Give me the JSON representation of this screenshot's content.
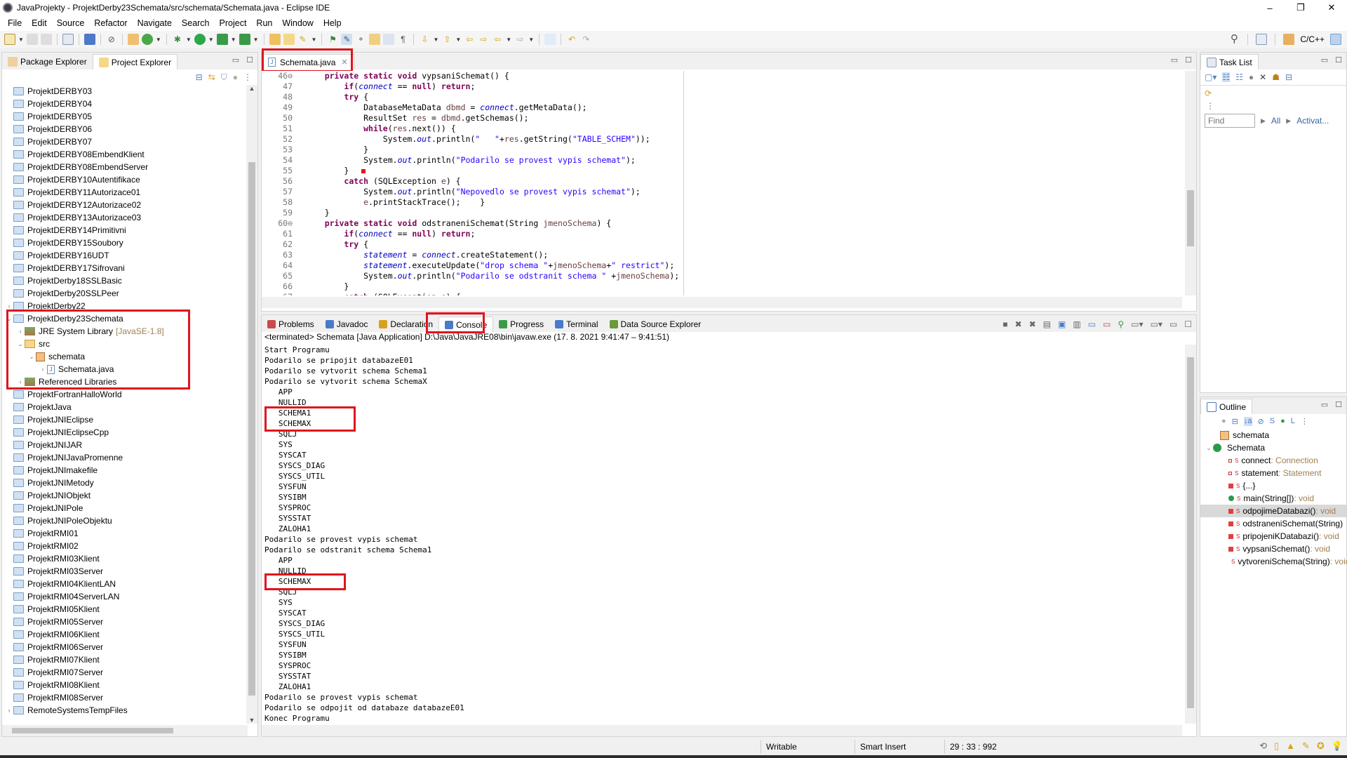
{
  "window": {
    "title": "JavaProjekty - ProjektDerby23Schemata/src/schemata/Schemata.java - Eclipse IDE",
    "controls": [
      "–",
      "❐",
      "✕"
    ]
  },
  "menu": [
    "File",
    "Edit",
    "Source",
    "Refactor",
    "Navigate",
    "Search",
    "Project",
    "Run",
    "Window",
    "Help"
  ],
  "toolbar": {
    "perspective_label": "C/C++"
  },
  "left_panel": {
    "tabs": [
      {
        "label": "Package Explorer",
        "active": false
      },
      {
        "label": "Project Explorer",
        "active": true
      }
    ],
    "tree": [
      {
        "label": "ProjektDERBY03",
        "level": 0,
        "type": "project"
      },
      {
        "label": "ProjektDERBY04",
        "level": 0,
        "type": "project"
      },
      {
        "label": "ProjektDERBY05",
        "level": 0,
        "type": "project"
      },
      {
        "label": "ProjektDERBY06",
        "level": 0,
        "type": "project"
      },
      {
        "label": "ProjektDERBY07",
        "level": 0,
        "type": "project"
      },
      {
        "label": "ProjektDERBY08EmbendKlient",
        "level": 0,
        "type": "project"
      },
      {
        "label": "ProjektDERBY08EmbendServer",
        "level": 0,
        "type": "project"
      },
      {
        "label": "ProjektDERBY10Autentifikace",
        "level": 0,
        "type": "project"
      },
      {
        "label": "ProjektDERBY11Autorizace01",
        "level": 0,
        "type": "project"
      },
      {
        "label": "ProjektDERBY12Autorizace02",
        "level": 0,
        "type": "project"
      },
      {
        "label": "ProjektDERBY13Autorizace03",
        "level": 0,
        "type": "project"
      },
      {
        "label": "ProjektDERBY14Primitivni",
        "level": 0,
        "type": "project"
      },
      {
        "label": "ProjektDERBY15Soubory",
        "level": 0,
        "type": "project"
      },
      {
        "label": "ProjektDERBY16UDT",
        "level": 0,
        "type": "project"
      },
      {
        "label": "ProjektDERBY17Sifrovani",
        "level": 0,
        "type": "project"
      },
      {
        "label": "ProjektDerby18SSLBasic",
        "level": 0,
        "type": "project"
      },
      {
        "label": "ProjektDerby20SSLPeer",
        "level": 0,
        "type": "project"
      },
      {
        "label": "ProjektDerby22",
        "level": 0,
        "type": "project-open",
        "twisty": ">"
      },
      {
        "label": "ProjektDerby23Schemata",
        "level": 0,
        "type": "project-open",
        "twisty": "v"
      },
      {
        "label": "JRE System Library",
        "suffix": "[JavaSE-1.8]",
        "level": 1,
        "type": "library",
        "twisty": ">"
      },
      {
        "label": "src",
        "level": 1,
        "type": "src",
        "twisty": "v"
      },
      {
        "label": "schemata",
        "level": 2,
        "type": "package",
        "twisty": "v"
      },
      {
        "label": "Schemata.java",
        "level": 3,
        "type": "java",
        "twisty": ">"
      },
      {
        "label": "Referenced Libraries",
        "level": 1,
        "type": "library",
        "twisty": ">"
      },
      {
        "label": "ProjektFortranHalloWorld",
        "level": 0,
        "type": "project"
      },
      {
        "label": "ProjektJava",
        "level": 0,
        "type": "project"
      },
      {
        "label": "ProjektJNIEclipse",
        "level": 0,
        "type": "project"
      },
      {
        "label": "ProjektJNIEclipseCpp",
        "level": 0,
        "type": "project"
      },
      {
        "label": "ProjektJNIJAR",
        "level": 0,
        "type": "project"
      },
      {
        "label": "ProjektJNIJavaPromenne",
        "level": 0,
        "type": "project"
      },
      {
        "label": "ProjektJNImakefile",
        "level": 0,
        "type": "project"
      },
      {
        "label": "ProjektJNIMetody",
        "level": 0,
        "type": "project"
      },
      {
        "label": "ProjektJNIObjekt",
        "level": 0,
        "type": "project"
      },
      {
        "label": "ProjektJNIPole",
        "level": 0,
        "type": "project"
      },
      {
        "label": "ProjektJNIPoleObjektu",
        "level": 0,
        "type": "project"
      },
      {
        "label": "ProjektRMI01",
        "level": 0,
        "type": "project"
      },
      {
        "label": "ProjektRMI02",
        "level": 0,
        "type": "project"
      },
      {
        "label": "ProjektRMI03Klient",
        "level": 0,
        "type": "project"
      },
      {
        "label": "ProjektRMI03Server",
        "level": 0,
        "type": "project"
      },
      {
        "label": "ProjektRMI04KlientLAN",
        "level": 0,
        "type": "project"
      },
      {
        "label": "ProjektRMI04ServerLAN",
        "level": 0,
        "type": "project"
      },
      {
        "label": "ProjektRMI05Klient",
        "level": 0,
        "type": "project"
      },
      {
        "label": "ProjektRMI05Server",
        "level": 0,
        "type": "project"
      },
      {
        "label": "ProjektRMI06Klient",
        "level": 0,
        "type": "project"
      },
      {
        "label": "ProjektRMI06Server",
        "level": 0,
        "type": "project"
      },
      {
        "label": "ProjektRMI07Klient",
        "level": 0,
        "type": "project"
      },
      {
        "label": "ProjektRMI07Server",
        "level": 0,
        "type": "project"
      },
      {
        "label": "ProjektRMI08Klient",
        "level": 0,
        "type": "project"
      },
      {
        "label": "ProjektRMI08Server",
        "level": 0,
        "type": "project"
      },
      {
        "label": "RemoteSystemsTempFiles",
        "level": 0,
        "type": "project-open",
        "twisty": ">"
      }
    ]
  },
  "editor": {
    "tab": "Schemata.java",
    "lines": [
      {
        "n": "46⊖",
        "code": [
          [
            "    ",
            ""
          ],
          [
            "private static void",
            "kw"
          ],
          [
            " vypsaniSchemat() {",
            ""
          ]
        ]
      },
      {
        "n": "47",
        "code": [
          [
            "        ",
            ""
          ],
          [
            "if",
            "kw"
          ],
          [
            "(",
            ""
          ],
          [
            "connect",
            "fld"
          ],
          [
            " == ",
            ""
          ],
          [
            "null",
            "kw"
          ],
          [
            ") ",
            ""
          ],
          [
            "return",
            "kw"
          ],
          [
            ";",
            ""
          ]
        ]
      },
      {
        "n": "48",
        "code": [
          [
            "        ",
            ""
          ],
          [
            "try",
            "kw"
          ],
          [
            " {",
            ""
          ]
        ]
      },
      {
        "n": "49",
        "code": [
          [
            "            DatabaseMetaData ",
            ""
          ],
          [
            "dbmd",
            "var"
          ],
          [
            " = ",
            ""
          ],
          [
            "connect",
            "fld"
          ],
          [
            ".getMetaData();",
            ""
          ]
        ]
      },
      {
        "n": "50",
        "code": [
          [
            "            ResultSet ",
            ""
          ],
          [
            "res",
            "var"
          ],
          [
            " = ",
            ""
          ],
          [
            "dbmd",
            "var"
          ],
          [
            ".getSchemas();",
            ""
          ]
        ]
      },
      {
        "n": "51",
        "code": [
          [
            "            ",
            ""
          ],
          [
            "while",
            "kw"
          ],
          [
            "(",
            ""
          ],
          [
            "res",
            "var"
          ],
          [
            ".next()) {",
            ""
          ]
        ]
      },
      {
        "n": "52",
        "code": [
          [
            "                System.",
            ""
          ],
          [
            "out",
            "fld"
          ],
          [
            ".println(",
            ""
          ],
          [
            "\"   \"",
            "str"
          ],
          [
            "+",
            ""
          ],
          [
            "res",
            "var"
          ],
          [
            ".getString(",
            ""
          ],
          [
            "\"TABLE_SCHEM\"",
            "str"
          ],
          [
            "));",
            ""
          ]
        ]
      },
      {
        "n": "53",
        "code": [
          [
            "            }",
            ""
          ]
        ]
      },
      {
        "n": "54",
        "code": [
          [
            "            System.",
            ""
          ],
          [
            "out",
            "fld"
          ],
          [
            ".println(",
            ""
          ],
          [
            "\"Podarilo se provest vypis schemat\"",
            "str"
          ],
          [
            ");",
            ""
          ]
        ]
      },
      {
        "n": "55",
        "code": [
          [
            "        }  ",
            ""
          ]
        ]
      },
      {
        "n": "56",
        "code": [
          [
            "        ",
            ""
          ],
          [
            "catch",
            "kw"
          ],
          [
            " (SQLException ",
            ""
          ],
          [
            "e",
            "var"
          ],
          [
            ") {",
            ""
          ]
        ]
      },
      {
        "n": "57",
        "code": [
          [
            "            System.",
            ""
          ],
          [
            "out",
            "fld"
          ],
          [
            ".println(",
            ""
          ],
          [
            "\"Nepovedlo se provest vypis schemat\"",
            "str"
          ],
          [
            ");",
            ""
          ]
        ]
      },
      {
        "n": "58",
        "code": [
          [
            "            ",
            ""
          ],
          [
            "e",
            "var"
          ],
          [
            ".printStackTrace();    }",
            ""
          ]
        ]
      },
      {
        "n": "59",
        "code": [
          [
            "    }",
            ""
          ]
        ]
      },
      {
        "n": "60⊖",
        "code": [
          [
            "    ",
            ""
          ],
          [
            "private static void",
            "kw"
          ],
          [
            " odstraneniSchemat(String ",
            ""
          ],
          [
            "jmenoSchema",
            "var"
          ],
          [
            ") {",
            ""
          ]
        ]
      },
      {
        "n": "61",
        "code": [
          [
            "        ",
            ""
          ],
          [
            "if",
            "kw"
          ],
          [
            "(",
            ""
          ],
          [
            "connect",
            "fld"
          ],
          [
            " == ",
            ""
          ],
          [
            "null",
            "kw"
          ],
          [
            ") ",
            ""
          ],
          [
            "return",
            "kw"
          ],
          [
            ";",
            ""
          ]
        ]
      },
      {
        "n": "62",
        "code": [
          [
            "        ",
            ""
          ],
          [
            "try",
            "kw"
          ],
          [
            " {",
            ""
          ]
        ]
      },
      {
        "n": "63",
        "code": [
          [
            "            ",
            ""
          ],
          [
            "statement",
            "fld"
          ],
          [
            " = ",
            ""
          ],
          [
            "connect",
            "fld"
          ],
          [
            ".createStatement();",
            ""
          ]
        ]
      },
      {
        "n": "64",
        "code": [
          [
            "            ",
            ""
          ],
          [
            "statement",
            "fld"
          ],
          [
            ".executeUpdate(",
            ""
          ],
          [
            "\"drop schema \"",
            "str"
          ],
          [
            "+",
            ""
          ],
          [
            "jmenoSchema",
            "var"
          ],
          [
            "+",
            ""
          ],
          [
            "\" restrict\"",
            "str"
          ],
          [
            ");",
            ""
          ]
        ]
      },
      {
        "n": "65",
        "code": [
          [
            "            System.",
            ""
          ],
          [
            "out",
            "fld"
          ],
          [
            ".println(",
            ""
          ],
          [
            "\"Podarilo se odstranit schema \"",
            "str"
          ],
          [
            " +",
            ""
          ],
          [
            "jmenoSchema",
            "var"
          ],
          [
            ");",
            ""
          ]
        ]
      },
      {
        "n": "66",
        "code": [
          [
            "        }",
            ""
          ]
        ]
      },
      {
        "n": "67",
        "code": [
          [
            "        ",
            ""
          ],
          [
            "catch",
            "kw"
          ],
          [
            " (SQLException e) {",
            ""
          ]
        ]
      }
    ]
  },
  "console_panel": {
    "tabs": [
      {
        "label": "Problems",
        "icon": "problems-icon"
      },
      {
        "label": "Javadoc",
        "icon": "javadoc-icon"
      },
      {
        "label": "Declaration",
        "icon": "declaration-icon"
      },
      {
        "label": "Console",
        "icon": "console-icon",
        "active": true
      },
      {
        "label": "Progress",
        "icon": "progress-icon"
      },
      {
        "label": "Terminal",
        "icon": "terminal-icon"
      },
      {
        "label": "Data Source Explorer",
        "icon": "data-source-icon"
      }
    ],
    "header": "<terminated> Schemata [Java Application] D:\\Java\\JavaJRE08\\bin\\javaw.exe  (17. 8. 2021 9:41:47 – 9:41:51)",
    "output": [
      "Start Programu",
      "Podarilo se pripojit databazeE01",
      "Podarilo se vytvorit schema Schema1",
      "Podarilo se vytvorit schema SchemaX",
      "   APP",
      "   NULLID",
      "   SCHEMA1",
      "   SCHEMAX",
      "   SQLJ",
      "   SYS",
      "   SYSCAT",
      "   SYSCS_DIAG",
      "   SYSCS_UTIL",
      "   SYSFUN",
      "   SYSIBM",
      "   SYSPROC",
      "   SYSSTAT",
      "   ZALOHA1",
      "Podarilo se provest vypis schemat",
      "Podarilo se odstranit schema Schema1",
      "   APP",
      "   NULLID",
      "   SCHEMAX",
      "   SQLJ",
      "   SYS",
      "   SYSCAT",
      "   SYSCS_DIAG",
      "   SYSCS_UTIL",
      "   SYSFUN",
      "   SYSIBM",
      "   SYSPROC",
      "   SYSSTAT",
      "   ZALOHA1",
      "Podarilo se provest vypis schemat",
      "Podarilo se odpojit od databaze databazeE01",
      "Konec Programu"
    ]
  },
  "task_list": {
    "tab": "Task List",
    "find_placeholder": "Find",
    "filter_all": "All",
    "filter_activate": "Activat..."
  },
  "outline": {
    "tab": "Outline",
    "items": [
      {
        "label": "schemata",
        "type": "package",
        "level": 0
      },
      {
        "label": "Schemata",
        "type": "class",
        "level": 0
      },
      {
        "label": "connect",
        "type_suffix": " : Connection",
        "kind": "field",
        "level": 1
      },
      {
        "label": "statement",
        "type_suffix": " : Statement",
        "kind": "field",
        "level": 1
      },
      {
        "label": "{...}",
        "type_suffix": "",
        "kind": "private",
        "level": 1
      },
      {
        "label": "main(String[])",
        "type_suffix": " : void",
        "kind": "public",
        "level": 1
      },
      {
        "label": "odpojimeDatabazi()",
        "type_suffix": " : void",
        "kind": "private",
        "level": 1,
        "selected": true
      },
      {
        "label": "odstraneniSchemat(String)",
        "type_suffix": "",
        "kind": "private",
        "level": 1
      },
      {
        "label": "pripojeniKDatabazi()",
        "type_suffix": " : void",
        "kind": "private",
        "level": 1
      },
      {
        "label": "vypsaniSchemat()",
        "type_suffix": " : void",
        "kind": "private",
        "level": 1
      },
      {
        "label": "vytvoreniSchema(String)",
        "type_suffix": " : void",
        "kind": "private",
        "level": 1
      }
    ]
  },
  "status_bar": {
    "writable": "Writable",
    "insert_mode": "Smart Insert",
    "position": "29 : 33 : 992"
  },
  "colors": {
    "highlight_box": "#e0141e",
    "keyword": "#7f0055",
    "string": "#2a00ff",
    "field": "#0000c0"
  }
}
